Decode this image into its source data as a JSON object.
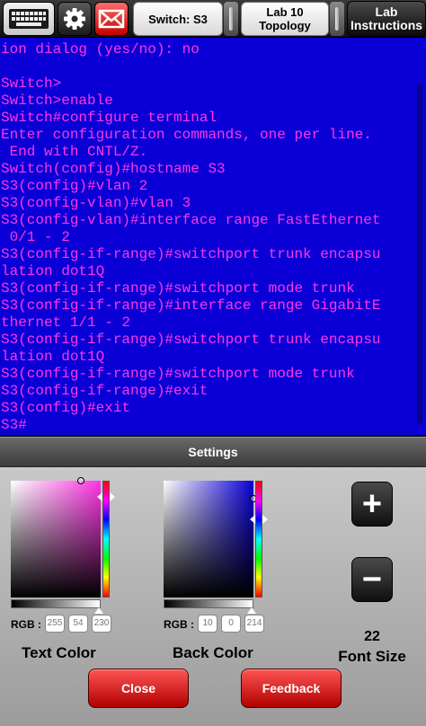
{
  "toolbar": {
    "switch_tab": "Switch: S3",
    "lab_tab": "Lab 10\nTopology",
    "instructions": "Lab\nInstructions"
  },
  "terminal": {
    "text_color": "#ff36e6",
    "background_color": "#0a00d6",
    "lines": [
      "ion dialog (yes/no): no",
      "",
      "Switch>",
      "Switch>enable",
      "Switch#configure terminal",
      "Enter configuration commands, one per line.",
      " End with CNTL/Z.",
      "Switch(config)#hostname S3",
      "S3(config)#vlan 2",
      "S3(config-vlan)#vlan 3",
      "S3(config-vlan)#interface range FastEthernet",
      " 0/1 - 2",
      "S3(config-if-range)#switchport trunk encapsu",
      "lation dot1Q",
      "S3(config-if-range)#switchport mode trunk",
      "S3(config-if-range)#interface range GigabitE",
      "thernet 1/1 - 2",
      "S3(config-if-range)#switchport trunk encapsu",
      "lation dot1Q",
      "S3(config-if-range)#switchport mode trunk",
      "S3(config-if-range)#exit",
      "S3(config)#exit",
      "S3#"
    ]
  },
  "settings": {
    "title": "Settings",
    "rgb_label": "RGB :",
    "text_color": {
      "label": "Text Color",
      "r": "255",
      "g": "54",
      "b": "230"
    },
    "back_color": {
      "label": "Back Color",
      "r": "10",
      "g": "0",
      "b": "214"
    },
    "font_size": {
      "value": "22",
      "label": "Font Size",
      "plus": "+",
      "minus": "−"
    },
    "close_label": "Close",
    "feedback_label": "Feedback"
  }
}
